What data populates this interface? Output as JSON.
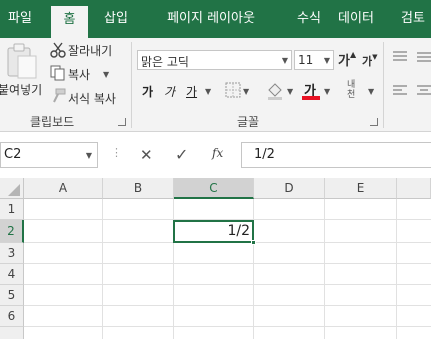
{
  "tabs": [
    {
      "label": "파일"
    },
    {
      "label": "홈"
    },
    {
      "label": "삽입"
    },
    {
      "label": "페이지 레이아웃"
    },
    {
      "label": "수식"
    },
    {
      "label": "데이터"
    },
    {
      "label": "검토"
    }
  ],
  "ribbon": {
    "clipboard": {
      "paste_label": "붙여넣기",
      "cut_label": "잘라내기",
      "copy_label": "복사",
      "format_painter_label": "서식 복사",
      "group_label": "클립보드"
    },
    "font": {
      "font_name": "맑은 고딕",
      "font_size": "11",
      "increase_label": "가",
      "decrease_label": "가",
      "bold_label": "가",
      "italic_label": "가",
      "underline_label": "가",
      "font_color_label": "가",
      "phonetic_label": "내천",
      "group_label": "글꼴",
      "font_color": "#e81123"
    }
  },
  "formula_bar": {
    "name_box": "C2",
    "cancel_symbol": "✕",
    "enter_symbol": "✓",
    "fx_label": "fx",
    "content": "1/2"
  },
  "sheet": {
    "columns": [
      "A",
      "B",
      "C",
      "D",
      "E"
    ],
    "rows": [
      "1",
      "2",
      "3",
      "4",
      "5",
      "6"
    ],
    "active_cell": "C2",
    "active_value": "1/2"
  },
  "colors": {
    "accent": "#217346"
  }
}
